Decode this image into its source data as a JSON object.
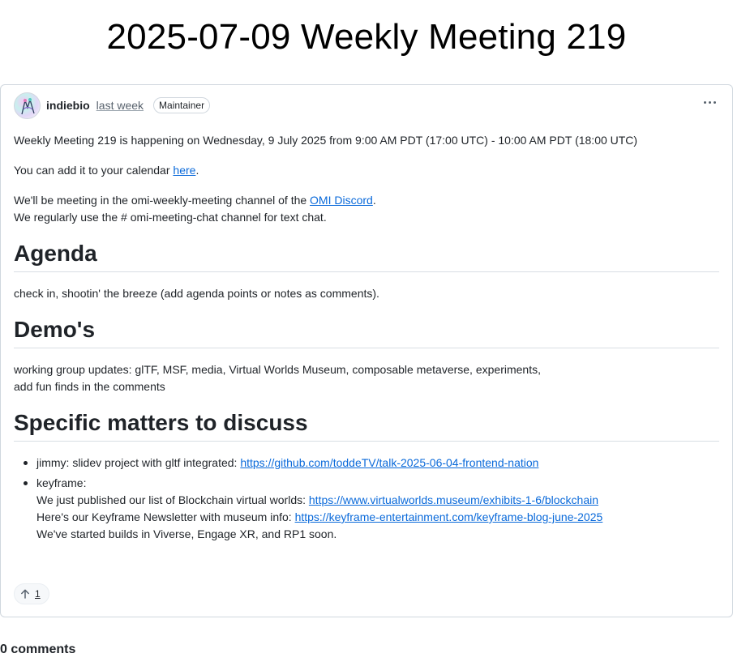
{
  "page": {
    "title": "2025-07-09 Weekly Meeting 219"
  },
  "post": {
    "author": "indiebio",
    "timestamp": "last week",
    "badge": "Maintainer",
    "intro_line": "Weekly Meeting 219 is happening on Wednesday, 9 July 2025 from 9:00 AM PDT (17:00 UTC) - 10:00 AM PDT (18:00 UTC)",
    "calendar_prefix": "You can add it to your calendar ",
    "calendar_link": "here",
    "calendar_suffix": ".",
    "discord_prefix": "We'll be meeting in the omi-weekly-meeting channel of the ",
    "discord_link": "OMI Discord",
    "discord_suffix": ".",
    "chat_line": "We regularly use the # omi-meeting-chat channel for text chat.",
    "agenda_heading": "Agenda",
    "agenda_text": "check in, shootin' the breeze (add agenda points or notes as comments).",
    "demos_heading": "Demo's",
    "demos_line1": "working group updates: glTF, MSF, media, Virtual Worlds Museum, composable metaverse, experiments,",
    "demos_line2": "add fun finds in the comments",
    "matters_heading": "Specific matters to discuss",
    "matters": {
      "item1_prefix": "jimmy: slidev project with gltf integrated: ",
      "item1_link": "https://github.com/toddeTV/talk-2025-06-04-frontend-nation",
      "item2_label": "keyframe:",
      "item2_line1_prefix": "We just published our list of Blockchain virtual worlds: ",
      "item2_line1_link": "https://www.virtualworlds.museum/exhibits-1-6/blockchain",
      "item2_line2_prefix": "Here's our Keyframe Newsletter with museum info: ",
      "item2_line2_link": "https://keyframe-entertainment.com/keyframe-blog-june-2025",
      "item2_line3": "We've started builds in Viverse, Engage XR, and RP1 soon."
    },
    "upvote_count": "1"
  },
  "comments": {
    "count_label": "0 comments"
  },
  "icons": {
    "avatar": "avatar-image",
    "more": "kebab-icon",
    "upvote": "arrow-up-icon"
  },
  "colors": {
    "link": "#0969da",
    "border": "#d0d7de",
    "text": "#1f2328",
    "muted": "#59636e"
  }
}
